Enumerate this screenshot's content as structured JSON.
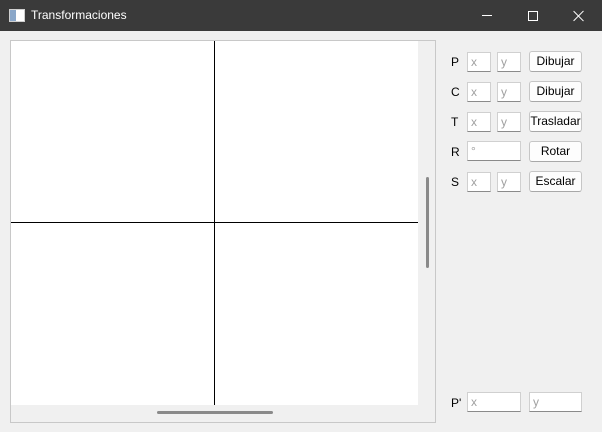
{
  "window": {
    "title": "Transformaciones",
    "icon": "app-window-icon"
  },
  "rows": [
    {
      "label": "P",
      "x_placeholder": "x",
      "y_placeholder": "y",
      "button": "Dibujar"
    },
    {
      "label": "C",
      "x_placeholder": "x",
      "y_placeholder": "y",
      "button": "Dibujar"
    },
    {
      "label": "T",
      "x_placeholder": "x",
      "y_placeholder": "y",
      "button": "Trasladar"
    },
    {
      "label": "R",
      "angle_placeholder": "°",
      "button": "Rotar"
    },
    {
      "label": "S",
      "x_placeholder": "x",
      "y_placeholder": "y",
      "button": "Escalar"
    }
  ],
  "result": {
    "label": "P'",
    "x_placeholder": "x",
    "y_placeholder": "y"
  }
}
